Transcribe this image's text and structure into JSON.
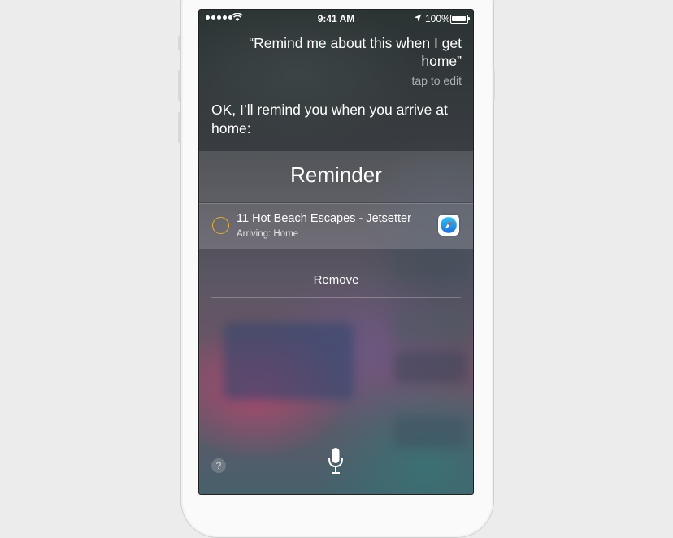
{
  "status_bar": {
    "time": "9:41 AM",
    "battery_percent": "100%",
    "signal_dots": 5,
    "icons": [
      "signal-dots-icon",
      "wifi-icon",
      "location-arrow-icon",
      "battery-icon"
    ]
  },
  "siri": {
    "query": "“Remind me about this when I get home”",
    "tap_to_edit": "tap to edit",
    "reply": "OK, I’ll remind you when you arrive at home:"
  },
  "reminder_card": {
    "title": "Reminder",
    "item": {
      "title": "11 Hot Beach Escapes - Jetsetter",
      "subtitle": "Arriving: Home",
      "app_icon": "safari-icon"
    },
    "remove_label": "Remove"
  },
  "bottom": {
    "help_label": "?",
    "mic_icon": "microphone-icon"
  },
  "colors": {
    "accent_circle": "#e6b320",
    "page_background": "#ececec"
  }
}
